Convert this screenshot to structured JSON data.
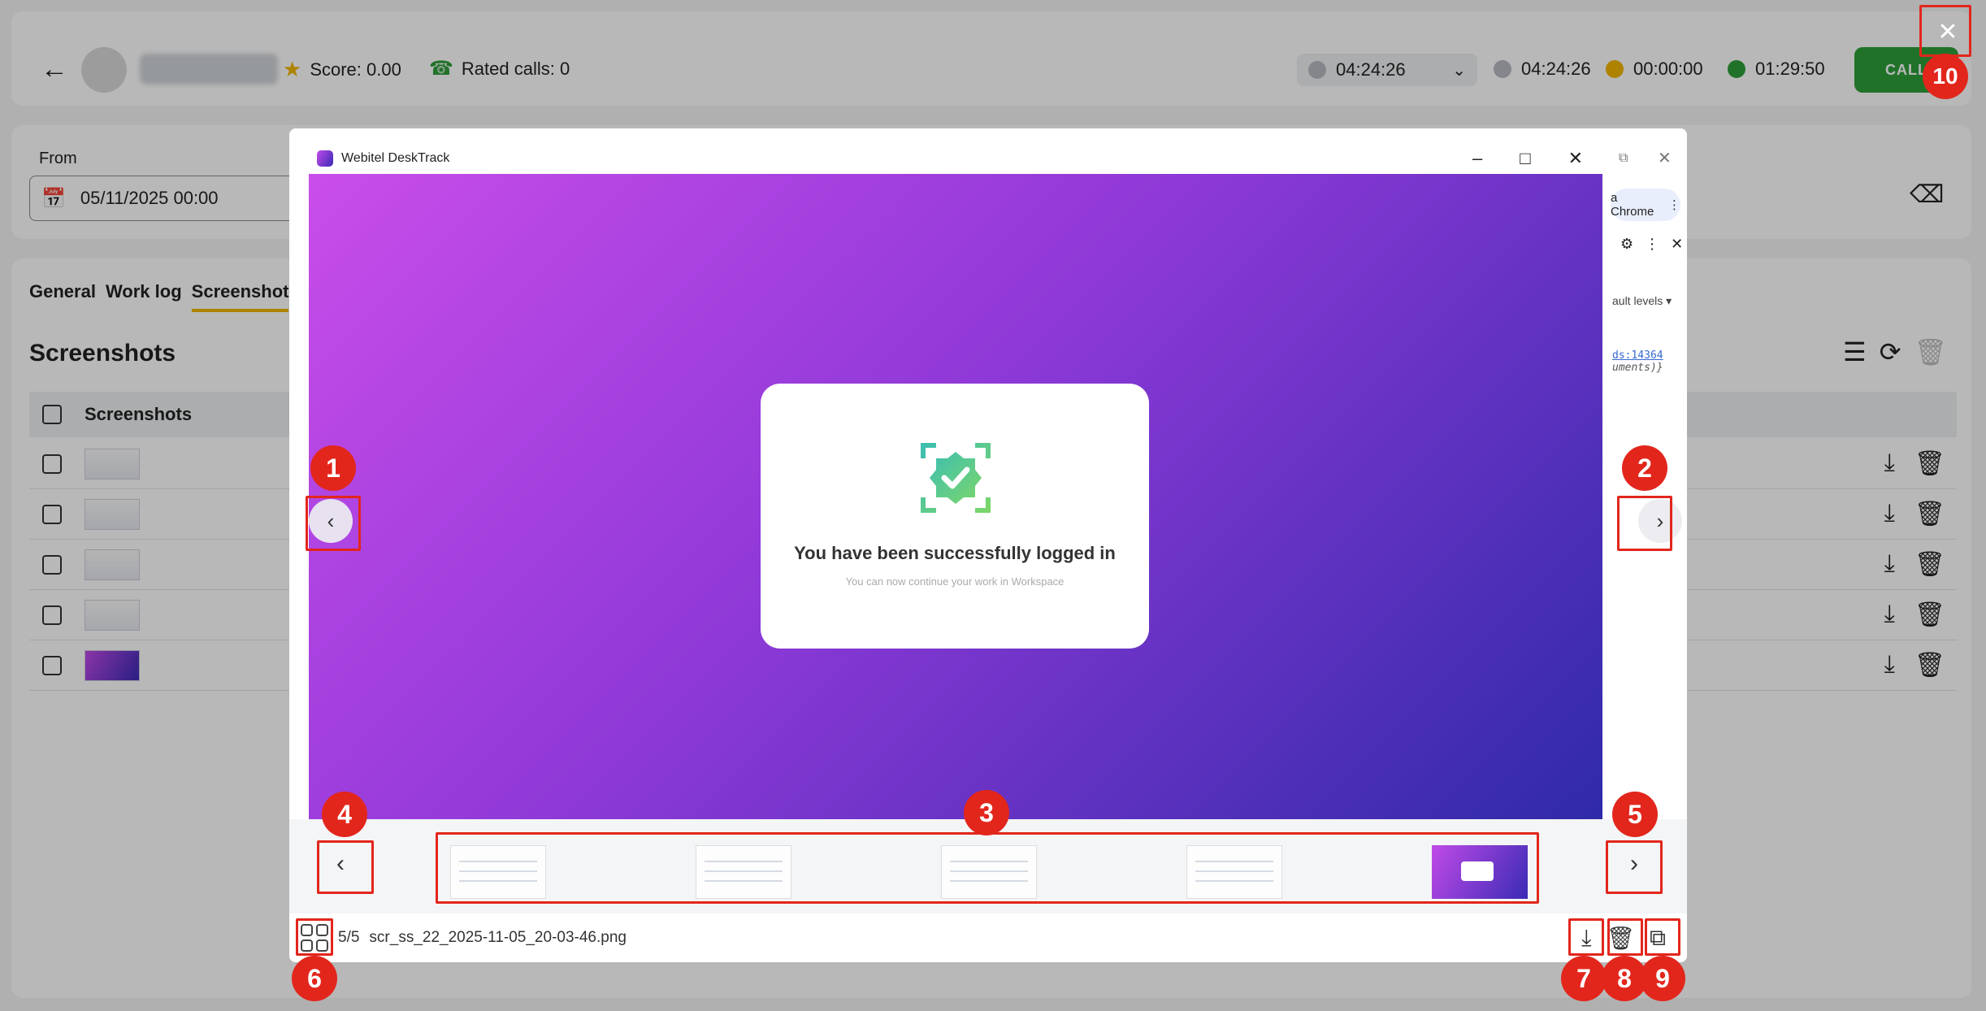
{
  "topbar": {
    "back_icon": "arrow-left-icon",
    "score": "Score: 0.00",
    "rated_calls": "Rated calls: 0",
    "status_time": "04:24:26",
    "timers": [
      {
        "value": "04:24:26",
        "color": "#b8bac2"
      },
      {
        "value": "00:00:00",
        "color": "#f2b600"
      },
      {
        "value": "01:29:50",
        "color": "#2e9e3a"
      }
    ],
    "call_label": "CALL"
  },
  "filters": {
    "from_label": "From",
    "from_value": "05/11/2025 00:00"
  },
  "tabs": [
    "General",
    "Work log",
    "Screenshot"
  ],
  "section_title": "Screenshots",
  "table": {
    "column": "Screenshots"
  },
  "viewer": {
    "app_title": "Webitel DeskTrack",
    "login_title": "You have been successfully logged in",
    "login_subtitle": "You can now continue your work in Workspace",
    "chrome_pill": "a Chrome",
    "chrome_levels": "ault levels ▾",
    "chrome_link": "ds:14364",
    "chrome_code": "uments)}",
    "counter": "5/5",
    "filename": "scr_ss_22_2025-11-05_20-03-46.png"
  },
  "annotations": [
    "1",
    "2",
    "3",
    "4",
    "5",
    "6",
    "7",
    "8",
    "9",
    "10"
  ],
  "colors": {
    "accent_red": "#e2261c",
    "call_green": "#2e9e3a",
    "tab_underline": "#f2b600"
  }
}
